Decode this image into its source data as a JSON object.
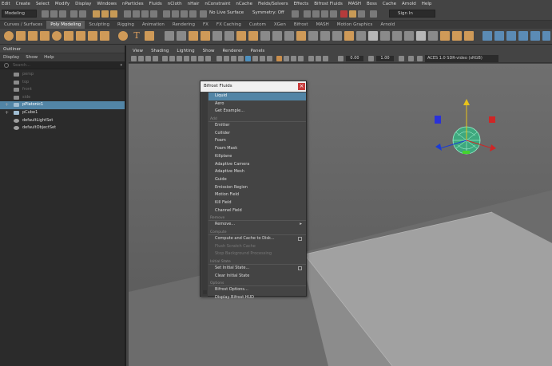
{
  "menubar": [
    "Edit",
    "Create",
    "Select",
    "Modify",
    "Display",
    "Windows",
    "nParticles",
    "Fluids",
    "nCloth",
    "nHair",
    "nConstraint",
    "nCache",
    "Fields/Solvers",
    "Effects",
    "Bifrost Fluids",
    "MASH",
    "Boss",
    "Cache",
    "Arnold",
    "Help"
  ],
  "status": {
    "mode": "Modeling",
    "live_surface": "No Live Surface",
    "symmetry": "Symmetry: Off",
    "signin": "Sign In"
  },
  "shelf_tabs": [
    "Curves / Surfaces",
    "Poly Modeling",
    "Sculpting",
    "Rigging",
    "Animation",
    "Rendering",
    "FX",
    "FX Caching",
    "Custom",
    "XGen",
    "Bifrost",
    "MASH",
    "Motion Graphics",
    "Arnold"
  ],
  "shelf_tabs_active": "Poly Modeling",
  "outliner": {
    "title": "Outliner",
    "menu": [
      "Display",
      "Show",
      "Help"
    ],
    "search_placeholder": "Search...",
    "items": [
      {
        "label": "persp",
        "icon": "camera-icon",
        "dim": true
      },
      {
        "label": "top",
        "icon": "camera-icon",
        "dim": true
      },
      {
        "label": "front",
        "icon": "camera-icon",
        "dim": true
      },
      {
        "label": "side",
        "icon": "camera-icon",
        "dim": true
      },
      {
        "label": "pPlatonic1",
        "icon": "mesh-icon",
        "selected": true
      },
      {
        "label": "pCube1",
        "icon": "mesh-icon"
      },
      {
        "label": "defaultLightSet",
        "icon": "set-icon"
      },
      {
        "label": "defaultObjectSet",
        "icon": "set-icon"
      }
    ]
  },
  "viewport_menu": [
    "View",
    "Shading",
    "Lighting",
    "Show",
    "Renderer",
    "Panels"
  ],
  "viewport_toolbar": {
    "exposure": "0.00",
    "gamma": "1.00",
    "color_space": "ACES 1.0 SDR-video (sRGB)"
  },
  "bifrost_menu": {
    "title": "Bifrost Fluids",
    "close": "×",
    "rows": [
      {
        "type": "item",
        "label": "Liquid",
        "active": true
      },
      {
        "type": "item",
        "label": "Aero"
      },
      {
        "type": "item",
        "label": "Get Example..."
      },
      {
        "type": "section",
        "label": "Add"
      },
      {
        "type": "item",
        "label": "Emitter"
      },
      {
        "type": "item",
        "label": "Collider"
      },
      {
        "type": "item",
        "label": "Foam"
      },
      {
        "type": "item",
        "label": "Foam Mask"
      },
      {
        "type": "item",
        "label": "Killplane"
      },
      {
        "type": "item",
        "label": "Adaptive Camera"
      },
      {
        "type": "item",
        "label": "Adaptive Mesh"
      },
      {
        "type": "item",
        "label": "Guide"
      },
      {
        "type": "item",
        "label": "Emission Region"
      },
      {
        "type": "item",
        "label": "Motion Field"
      },
      {
        "type": "item",
        "label": "Kill Field"
      },
      {
        "type": "item",
        "label": "Channel Field"
      },
      {
        "type": "section",
        "label": "Remove"
      },
      {
        "type": "item",
        "label": "Remove...",
        "submenu": true
      },
      {
        "type": "section",
        "label": "Compute"
      },
      {
        "type": "item",
        "label": "Compute and Cache to Disk...",
        "option": true
      },
      {
        "type": "item",
        "label": "Flush Scratch Cache",
        "disabled": true
      },
      {
        "type": "item",
        "label": "Stop Background Processing",
        "disabled": true
      },
      {
        "type": "section",
        "label": "Initial State"
      },
      {
        "type": "item",
        "label": "Set Initial State...",
        "option": true
      },
      {
        "type": "item",
        "label": "Clear Initial State"
      },
      {
        "type": "section",
        "label": "Options"
      },
      {
        "type": "item",
        "label": "Bifrost Options..."
      },
      {
        "type": "item",
        "label": "Display Bifrost HUD"
      }
    ]
  }
}
